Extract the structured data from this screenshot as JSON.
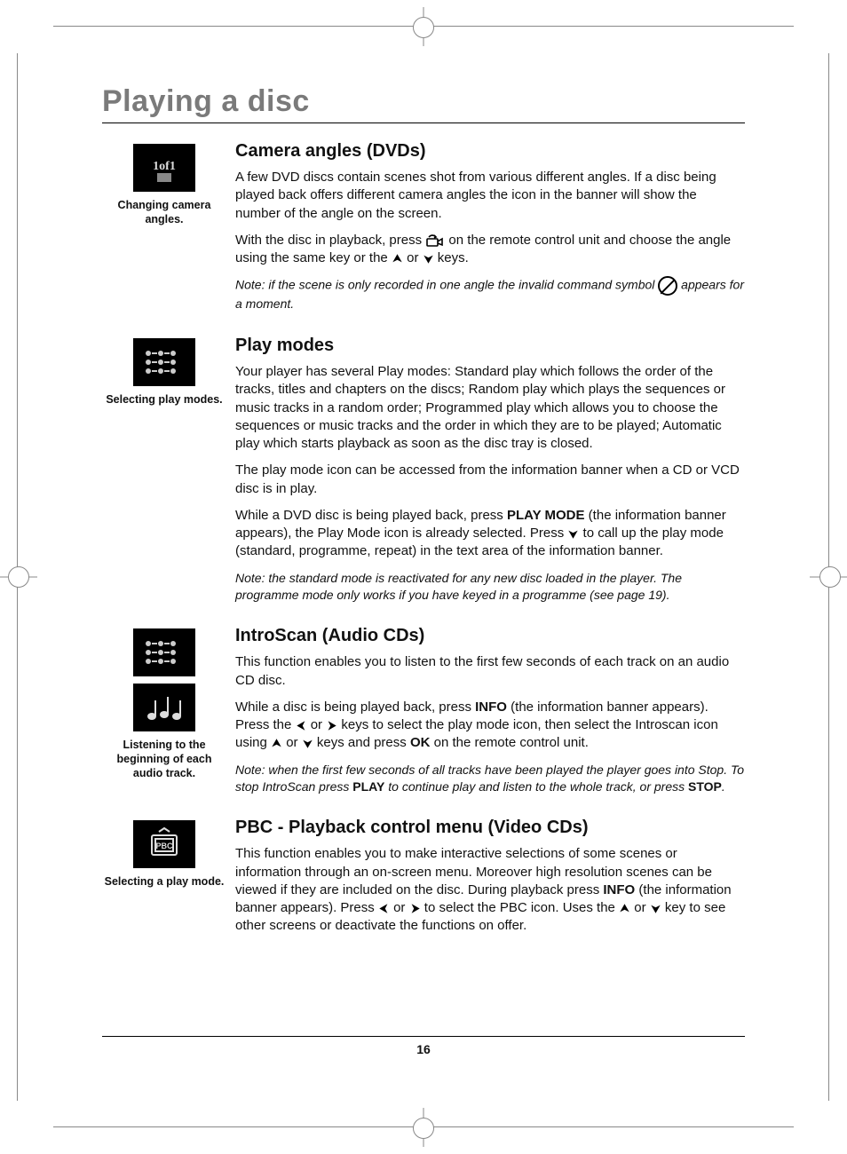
{
  "page_title": "Playing a disc",
  "page_number": "16",
  "sections": [
    {
      "heading": "Camera angles (DVDs)",
      "side_caption": "Changing camera angles.",
      "paragraphs": [
        "A few DVD discs contain scenes shot from various different angles. If a disc being played back offers different camera angles the icon in the banner will show the number of the angle on the screen.",
        "With the disc in playback, press [ANGLE] on the remote control unit and choose the angle using the same key or the [UP] or [DOWN] keys."
      ],
      "note": "Note: if the scene is only recorded in one angle the invalid command symbol [PROHIBIT] appears for a moment."
    },
    {
      "heading": "Play modes",
      "side_caption": "Selecting play modes.",
      "paragraphs": [
        "Your player has several Play modes: Standard play which follows the order of the tracks, titles and chapters on the discs; Random play which plays the sequences or music tracks in a random order; Programmed play which allows you to choose the sequences or music tracks and the order in which they are to be played; Automatic play which starts playback as soon as the disc tray is closed.",
        "The play mode icon can be accessed from the information banner when a CD or VCD disc is in play.",
        "While a DVD disc is being played back, press <b>PLAY MODE</b> (the information banner appears), the Play Mode icon is already selected. Press [DOWN] to call up the play mode (standard, programme, repeat) in the text area of the information banner."
      ],
      "note": "Note: the standard mode is reactivated for any new disc loaded in the player. The programme mode only works if you have keyed in a programme (see page 19)."
    },
    {
      "heading": "IntroScan (Audio CDs)",
      "side_caption": "Listening to the beginning of each audio track.",
      "paragraphs": [
        "This function enables you to listen to the first few seconds of each track on an audio CD disc.",
        "While a disc is being played back, press <b>INFO</b> (the information banner appears). Press the [LEFT] or [RIGHT] keys to select the play mode icon, then select the Introscan icon using [UP] or [DOWN] keys and press <b>OK</b> on the remote control unit."
      ],
      "note": "Note: when the first few seconds of all tracks have been played the player goes into Stop. To stop IntroScan press <b>PLAY</b> to continue play and listen to the whole track, or press <b>STOP</b>."
    },
    {
      "heading": "PBC - Playback control menu (Video CDs)",
      "side_caption": "Selecting a play mode.",
      "paragraphs": [
        "This function enables you to make interactive selections of some scenes or information through an on-screen menu. Moreover high resolution scenes can be viewed if they are included on the disc. During playback press <b>INFO</b> (the information banner appears). Press [LEFT] or [RIGHT] to select the PBC icon. Uses the [UP] or [DOWN] key to see other screens or deactivate the functions on offer."
      ]
    }
  ]
}
